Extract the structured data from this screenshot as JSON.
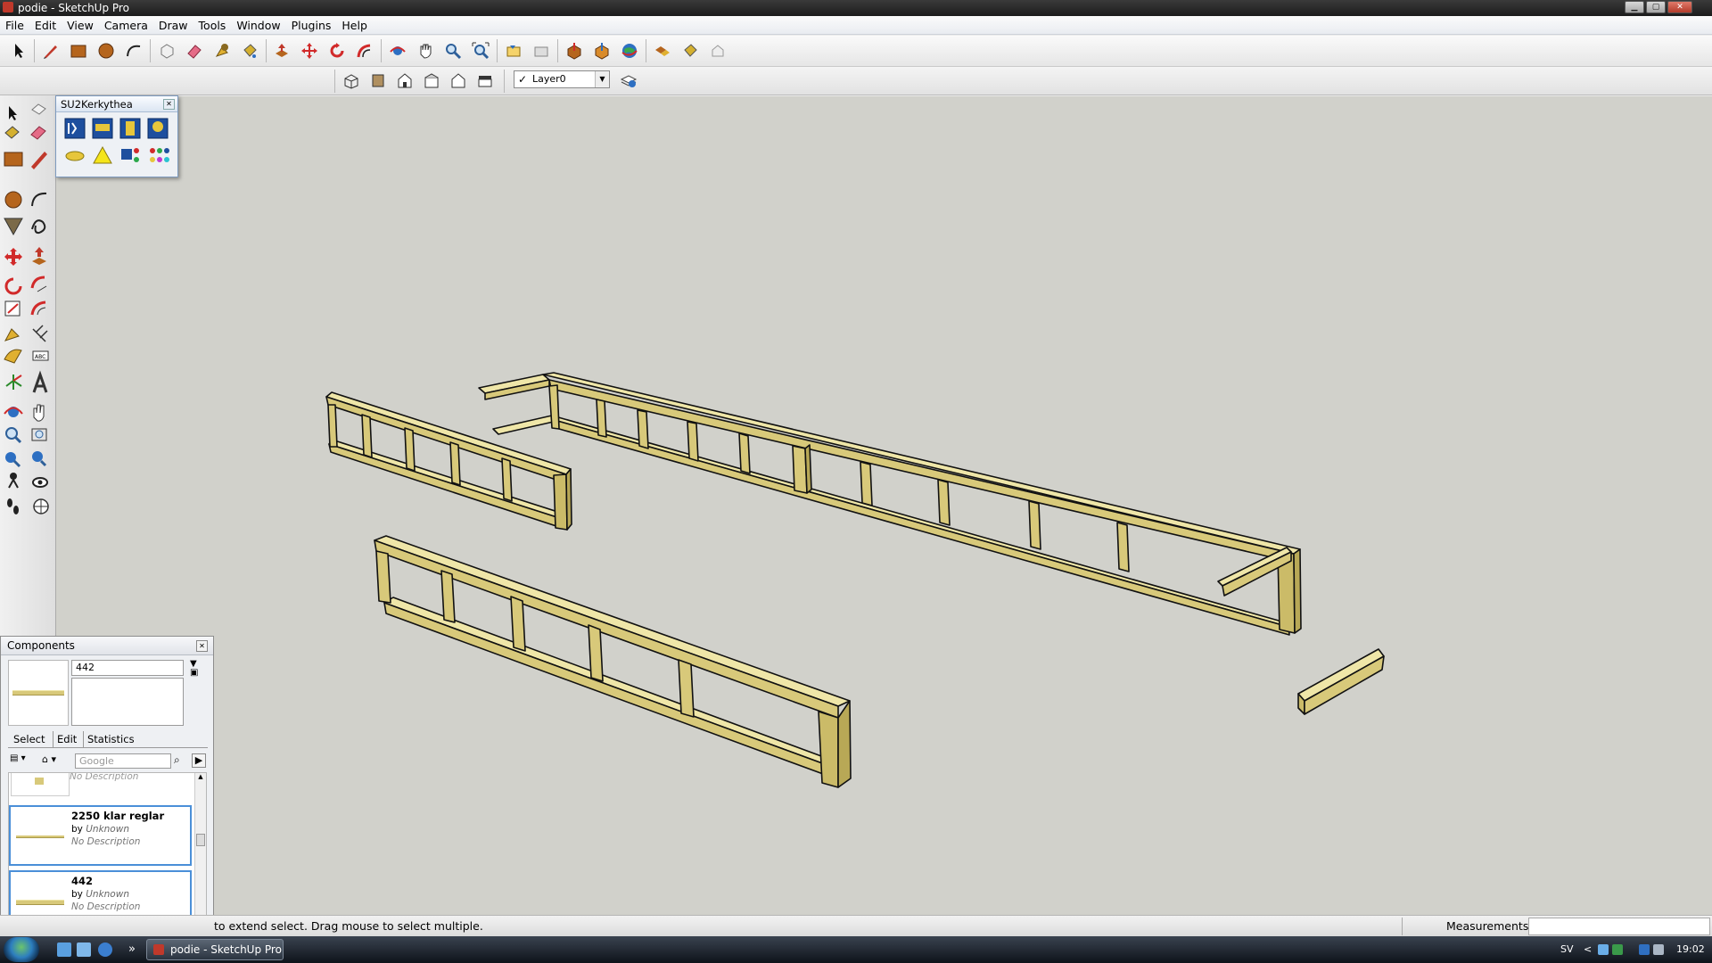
{
  "window": {
    "title": "podie - SketchUp Pro",
    "min": "▁",
    "max": "▢",
    "close": "✕"
  },
  "menu": [
    "File",
    "Edit",
    "View",
    "Camera",
    "Draw",
    "Tools",
    "Window",
    "Plugins",
    "Help"
  ],
  "layer": {
    "check": "✓",
    "name": "Layer0",
    "arrow": "▼"
  },
  "kerkythea": {
    "title": "SU2Kerkythea",
    "close": "✕"
  },
  "components": {
    "title": "Components",
    "close": "✕",
    "name_value": "442",
    "tabs": [
      "Select",
      "Edit",
      "Statistics"
    ],
    "search_placeholder": "Google",
    "partial_desc": "No Description",
    "items": [
      {
        "name": "2250 klar reglar",
        "by": "by",
        "author": "Unknown",
        "desc": "No Description"
      },
      {
        "name": "442",
        "by": "by",
        "author": "Unknown",
        "desc": "No Description"
      }
    ]
  },
  "status": {
    "message": "to extend select. Drag mouse to select multiple.",
    "measurements_label": "Measurements"
  },
  "taskbar": {
    "task_label": "podie - SketchUp Pro",
    "lang": "SV",
    "clock": "19:02",
    "chevron": "»",
    "tray_chevron": "<"
  },
  "colors": {
    "wood": "#d8c97a",
    "wood_top": "#ede3a3",
    "wood_dark": "#a8984a",
    "viewport": "#d1d1cb",
    "select_blue": "#4a8fd8"
  }
}
